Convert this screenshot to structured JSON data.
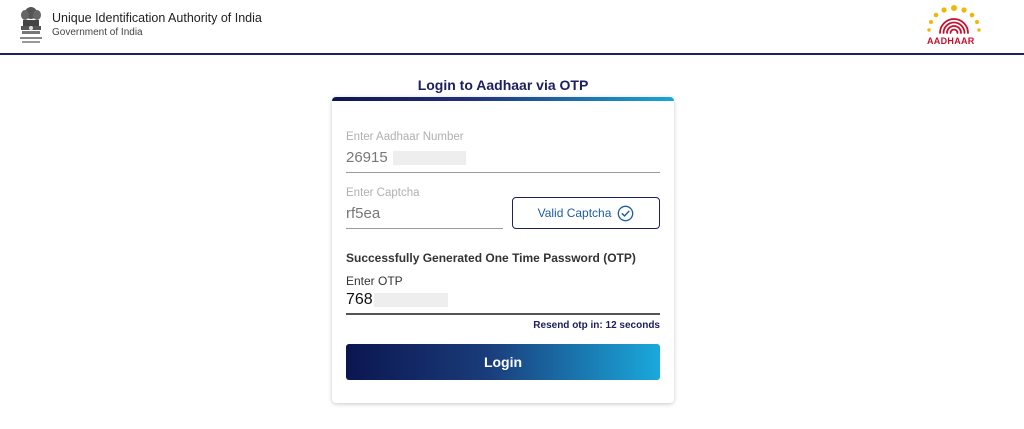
{
  "header": {
    "org_name": "Unique Identification Authority of India",
    "org_sub": "Government of India",
    "logo_text": "AADHAAR"
  },
  "login": {
    "title": "Login to Aadhaar via OTP",
    "aadhaar_label": "Enter Aadhaar Number",
    "aadhaar_value": "26915",
    "captcha_label": "Enter Captcha",
    "captcha_value": "rf5ea",
    "captcha_button": "Valid Captcha",
    "success_message": "Successfully Generated One Time Password (OTP)",
    "otp_label": "Enter OTP",
    "otp_value": "768",
    "resend": "Resend otp in: 12 seconds",
    "login_button": "Login"
  },
  "colors": {
    "brand_navy": "#1c2060",
    "gradient_start": "#0b1650",
    "gradient_end": "#1aa9dc",
    "logo_red": "#c8102e",
    "logo_yellow": "#f2b705"
  },
  "icons": {
    "emblem": "national-emblem-icon",
    "logo": "aadhaar-logo",
    "valid": "check-circle-icon"
  }
}
